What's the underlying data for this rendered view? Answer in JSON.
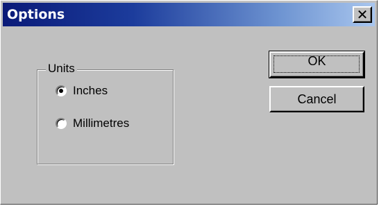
{
  "window": {
    "title": "Options",
    "close_glyph": "✕"
  },
  "units_group": {
    "label": "Units",
    "options": [
      {
        "label": "Inches",
        "selected": true
      },
      {
        "label": "Millimetres",
        "selected": false
      }
    ]
  },
  "buttons": {
    "ok_label": "OK",
    "cancel_label": "Cancel"
  },
  "colors": {
    "face": "#c0c0c0",
    "title_start": "#0a1a78",
    "title_end": "#a9c6ee"
  }
}
